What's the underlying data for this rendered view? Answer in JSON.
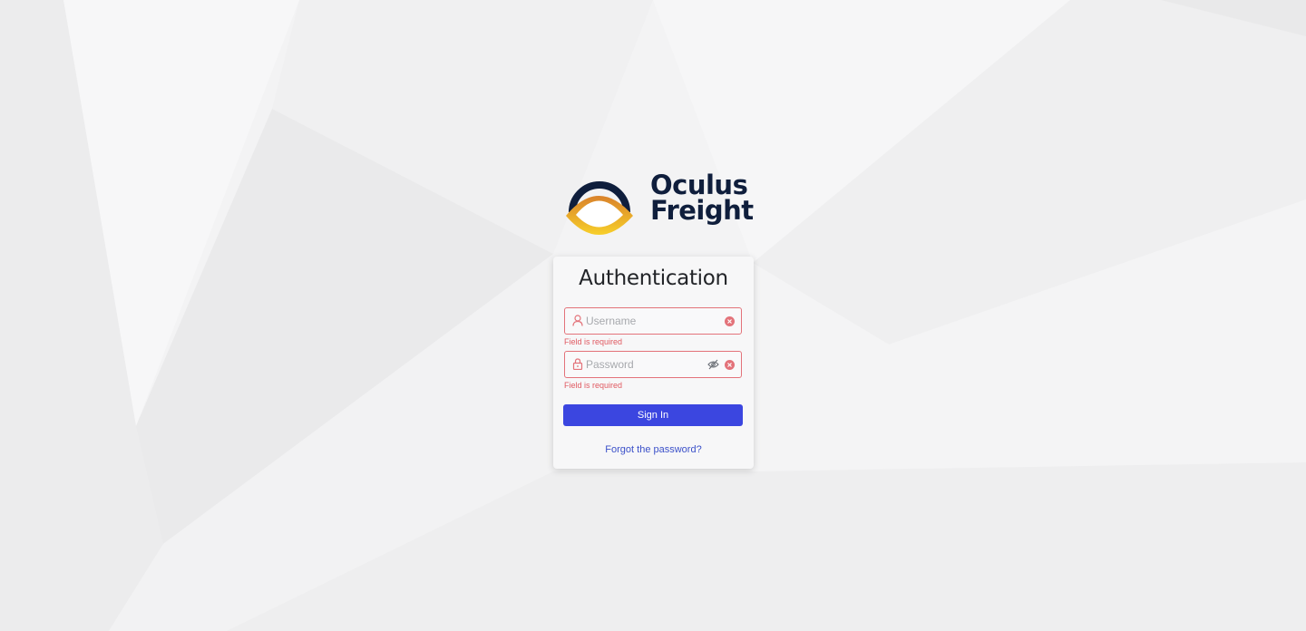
{
  "brand": {
    "line1": "Oculus",
    "line2": "Freight",
    "colors": {
      "navy": "#0f1e3c",
      "gold": "#f1b31e",
      "orange": "#d9822b"
    }
  },
  "card": {
    "title": "Authentication"
  },
  "form": {
    "username": {
      "placeholder": "Username",
      "value": "",
      "error": "Field is required",
      "icon": "user-icon"
    },
    "password": {
      "placeholder": "Password",
      "value": "",
      "error": "Field is required",
      "icon": "lock-icon"
    },
    "submit_label": "Sign In",
    "forgot_label": "Forgot the password?"
  },
  "colors": {
    "primary": "#3b46e0",
    "error": "#e05a62",
    "link": "#3b50c9",
    "background": "#f3f3f4"
  }
}
